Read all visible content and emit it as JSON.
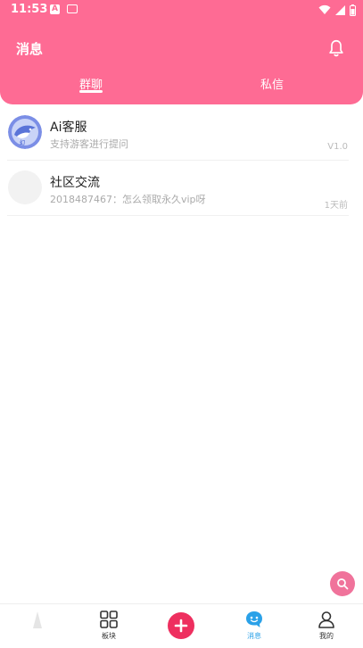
{
  "status_bar": {
    "time": "11:53",
    "notif_icons": [
      "a-icon",
      "card-icon"
    ],
    "right_icons": [
      "wifi-icon",
      "signal-icon",
      "battery-icon"
    ]
  },
  "header": {
    "title": "消息",
    "bell_icon": "bell-icon",
    "tabs": [
      {
        "label": "群聊",
        "active": true
      },
      {
        "label": "私信",
        "active": false
      }
    ]
  },
  "conversations": [
    {
      "name": "Ai客服",
      "preview": "支持游客进行提问",
      "meta": "V1.0",
      "avatar": "dolphin-avatar"
    },
    {
      "name": "社区交流",
      "preview": "2018487467：怎么领取永久vip呀",
      "meta": "1天前",
      "avatar": "placeholder-avatar"
    }
  ],
  "fab": {
    "icon": "search-icon"
  },
  "bottom_nav": {
    "items": [
      {
        "label": "板块",
        "icon": "grid-icon",
        "active": false
      },
      {
        "label": "",
        "icon": "plus-icon",
        "active": false
      },
      {
        "label": "消息",
        "icon": "chat-face-icon",
        "active": true
      },
      {
        "label": "我的",
        "icon": "person-icon",
        "active": false
      }
    ]
  },
  "colors": {
    "accent": "#fe6b94",
    "add_button": "#ee2f5f",
    "active_nav": "#2aa1e8"
  }
}
